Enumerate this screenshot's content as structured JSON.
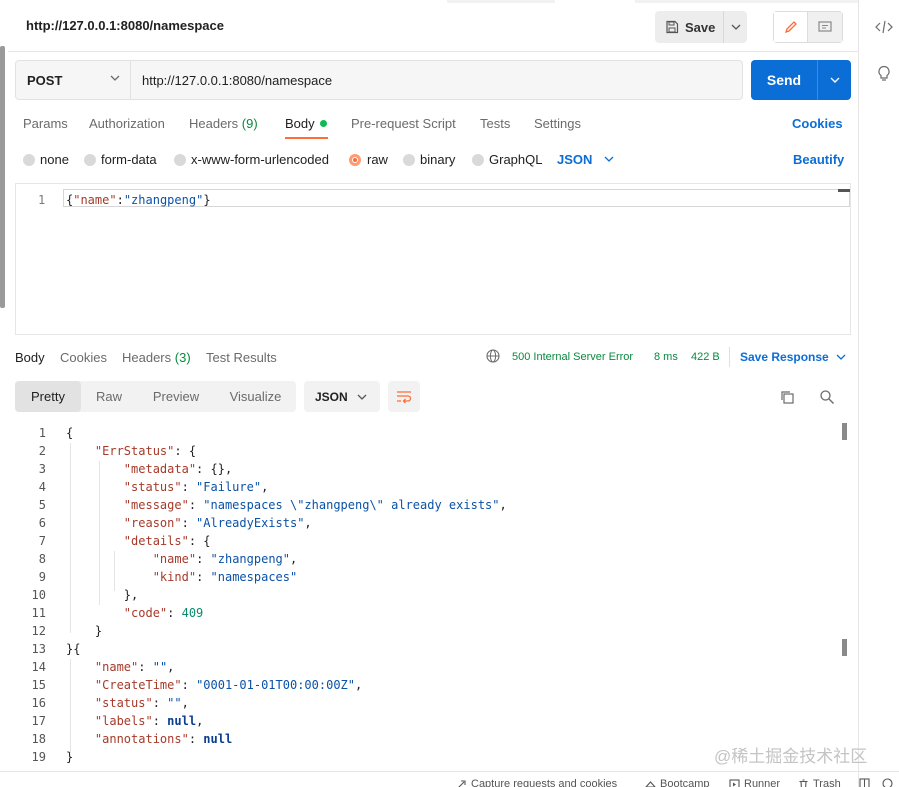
{
  "header": {
    "title": "http://127.0.0.1:8080/namespace",
    "save_label": "Save"
  },
  "request": {
    "method": "POST",
    "url": "http://127.0.0.1:8080/namespace",
    "send_label": "Send",
    "tabs": {
      "params": "Params",
      "authorization": "Authorization",
      "headers": "Headers",
      "headers_count": "(9)",
      "body": "Body",
      "prerequest": "Pre-request Script",
      "tests": "Tests",
      "settings": "Settings",
      "cookies": "Cookies"
    },
    "body_types": {
      "none": "none",
      "form_data": "form-data",
      "urlencoded": "x-www-form-urlencoded",
      "raw": "raw",
      "binary": "binary",
      "graphql": "GraphQL",
      "format": "JSON",
      "beautify": "Beautify"
    },
    "body_line_number": "1",
    "body_open": "{",
    "body_key": "\"name\"",
    "body_colon": ":",
    "body_value": "\"zhangpeng\"",
    "body_close": "}"
  },
  "response": {
    "tabs": {
      "body": "Body",
      "cookies": "Cookies",
      "headers": "Headers",
      "headers_count": "(3)",
      "test_results": "Test Results"
    },
    "status": "500 Internal Server Error",
    "time": "8 ms",
    "size": "422 B",
    "save_response": "Save Response",
    "views": {
      "pretty": "Pretty",
      "raw": "Raw",
      "preview": "Preview",
      "visualize": "Visualize"
    },
    "format": "JSON"
  },
  "statusbar": {
    "capture": "Capture requests and cookies",
    "bootcamp": "Bootcamp",
    "runner": "Runner",
    "trash": "Trash"
  },
  "watermark": "@稀土掘金技术社区",
  "colors": {
    "accent": "#ff6c37",
    "send": "#0b6dd6",
    "status_ok_green": "#0a8a3f"
  }
}
